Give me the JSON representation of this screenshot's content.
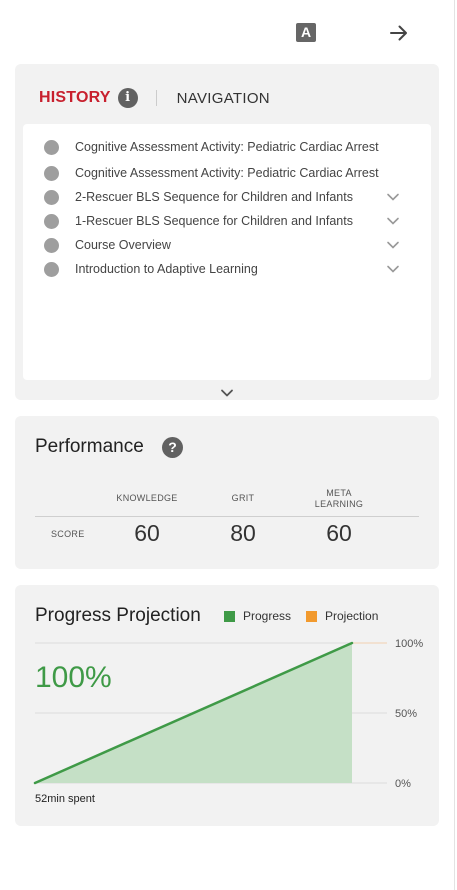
{
  "toolbar": {
    "font_button_label": "A",
    "font_button_icon": "text-size-icon",
    "next_icon": "arrow-right-icon"
  },
  "history_panel": {
    "tab_history": "HISTORY",
    "tab_navigation": "NAVIGATION",
    "info_glyph": "i",
    "items": [
      {
        "label": "Cognitive Assessment Activity: Pediatric Cardiac Arrest",
        "expandable": false
      },
      {
        "label": "Cognitive Assessment Activity: Pediatric Cardiac Arrest",
        "expandable": false
      },
      {
        "label": "2-Rescuer BLS Sequence for Children and Infants",
        "expandable": true
      },
      {
        "label": "1-Rescuer BLS Sequence for Children and Infants",
        "expandable": true
      },
      {
        "label": "Course Overview",
        "expandable": true
      },
      {
        "label": "Introduction to Adaptive Learning",
        "expandable": true
      }
    ]
  },
  "performance": {
    "title": "Performance",
    "help_glyph": "?",
    "columns": [
      "KNOWLEDGE",
      "GRIT",
      "META\nLEARNING"
    ],
    "row_label": "SCORE",
    "scores": [
      "60",
      "80",
      "60"
    ]
  },
  "projection": {
    "title": "Progress Projection",
    "legend_progress": "Progress",
    "legend_projection": "Projection",
    "big_value": "100%",
    "time_spent": "52min spent",
    "colors": {
      "progress": "#3f9a47",
      "projection": "#f29a2e",
      "fill": "#c5e0c6"
    }
  },
  "chart_data": {
    "type": "area",
    "series": [
      {
        "name": "Progress",
        "x": [
          0,
          1
        ],
        "values": [
          0,
          100
        ]
      },
      {
        "name": "Projection",
        "x": [],
        "values": []
      }
    ],
    "yticks": [
      "100%",
      "50%",
      "0%"
    ],
    "ylim": [
      0,
      100
    ],
    "grid": true,
    "legend": "top-right"
  }
}
